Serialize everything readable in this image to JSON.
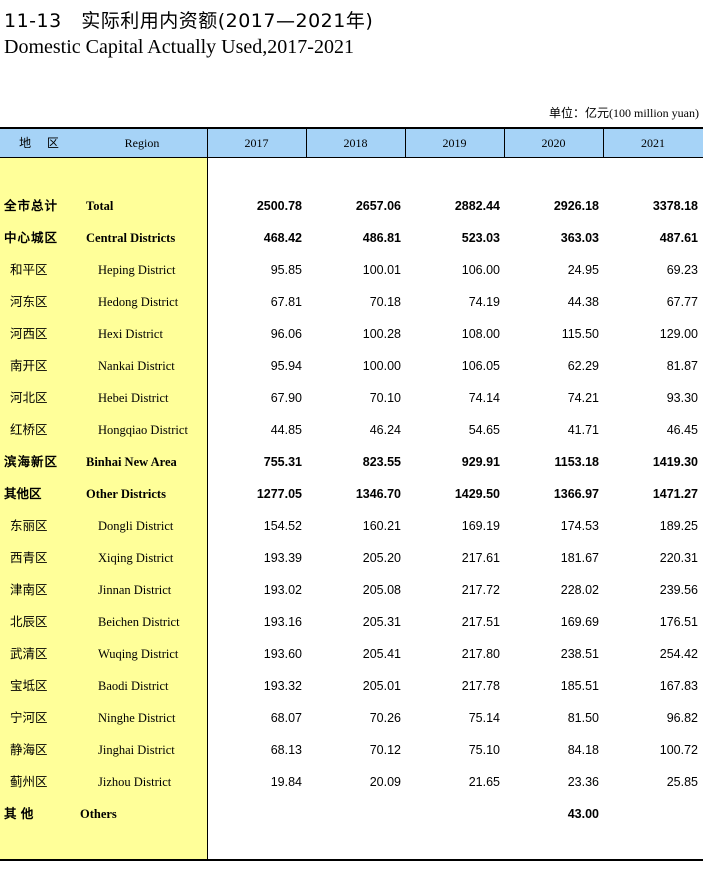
{
  "title_cn": "11-13　实际利用内资额(2017—2021年)",
  "title_en": "Domestic Capital Actually Used,2017-2021",
  "unit_cn": "单位：亿元",
  "unit_en": "(100 million yuan)",
  "header": {
    "region_cn": "地 区",
    "region_en": "Region",
    "years": [
      "2017",
      "2018",
      "2019",
      "2020",
      "2021"
    ]
  },
  "rows": [
    {
      "cn": "全市总计",
      "en": "Total",
      "bold": true,
      "level": "top",
      "values": [
        "2500.78",
        "2657.06",
        "2882.44",
        "2926.18",
        "3378.18"
      ]
    },
    {
      "cn": "中心城区",
      "en": "Central Districts",
      "bold": true,
      "level": "top",
      "values": [
        "468.42",
        "486.81",
        "523.03",
        "363.03",
        "487.61"
      ]
    },
    {
      "cn": "和平区",
      "en": "Heping District",
      "bold": false,
      "level": "sub",
      "values": [
        "95.85",
        "100.01",
        "106.00",
        "24.95",
        "69.23"
      ]
    },
    {
      "cn": "河东区",
      "en": "Hedong District",
      "bold": false,
      "level": "sub",
      "values": [
        "67.81",
        "70.18",
        "74.19",
        "44.38",
        "67.77"
      ]
    },
    {
      "cn": "河西区",
      "en": "Hexi District",
      "bold": false,
      "level": "sub",
      "values": [
        "96.06",
        "100.28",
        "108.00",
        "115.50",
        "129.00"
      ]
    },
    {
      "cn": "南开区",
      "en": "Nankai District",
      "bold": false,
      "level": "sub",
      "values": [
        "95.94",
        "100.00",
        "106.05",
        "62.29",
        "81.87"
      ]
    },
    {
      "cn": "河北区",
      "en": "Hebei District",
      "bold": false,
      "level": "sub",
      "values": [
        "67.90",
        "70.10",
        "74.14",
        "74.21",
        "93.30"
      ]
    },
    {
      "cn": "红桥区",
      "en": "Hongqiao District",
      "bold": false,
      "level": "sub",
      "values": [
        "44.85",
        "46.24",
        "54.65",
        "41.71",
        "46.45"
      ]
    },
    {
      "cn": "滨海新区",
      "en": "Binhai New Area",
      "bold": true,
      "level": "top",
      "values": [
        "755.31",
        "823.55",
        "929.91",
        "1153.18",
        "1419.30"
      ]
    },
    {
      "cn": "其他区",
      "en": "Other Districts",
      "bold": true,
      "level": "top",
      "values": [
        "1277.05",
        "1346.70",
        "1429.50",
        "1366.97",
        "1471.27"
      ]
    },
    {
      "cn": "东丽区",
      "en": "Dongli District",
      "bold": false,
      "level": "sub",
      "values": [
        "154.52",
        "160.21",
        "169.19",
        "174.53",
        "189.25"
      ]
    },
    {
      "cn": "西青区",
      "en": "Xiqing District",
      "bold": false,
      "level": "sub",
      "values": [
        "193.39",
        "205.20",
        "217.61",
        "181.67",
        "220.31"
      ]
    },
    {
      "cn": "津南区",
      "en": "Jinnan District",
      "bold": false,
      "level": "sub",
      "values": [
        "193.02",
        "205.08",
        "217.72",
        "228.02",
        "239.56"
      ]
    },
    {
      "cn": "北辰区",
      "en": "Beichen District",
      "bold": false,
      "level": "sub",
      "values": [
        "193.16",
        "205.31",
        "217.51",
        "169.69",
        "176.51"
      ]
    },
    {
      "cn": "武清区",
      "en": "Wuqing District",
      "bold": false,
      "level": "sub",
      "values": [
        "193.60",
        "205.41",
        "217.80",
        "238.51",
        "254.42"
      ]
    },
    {
      "cn": "宝坻区",
      "en": "Baodi District",
      "bold": false,
      "level": "sub",
      "values": [
        "193.32",
        "205.01",
        "217.78",
        "185.51",
        "167.83"
      ]
    },
    {
      "cn": "宁河区",
      "en": "Ninghe District",
      "bold": false,
      "level": "sub",
      "values": [
        "68.07",
        "70.26",
        "75.14",
        "81.50",
        "96.82"
      ]
    },
    {
      "cn": "静海区",
      "en": "Jinghai District",
      "bold": false,
      "level": "sub",
      "values": [
        "68.13",
        "70.12",
        "75.10",
        "84.18",
        "100.72"
      ]
    },
    {
      "cn": "蓟州区",
      "en": "Jizhou District",
      "bold": false,
      "level": "sub",
      "values": [
        "19.84",
        "20.09",
        "21.65",
        "23.36",
        "25.85"
      ]
    },
    {
      "cn": "其 他",
      "en": "Others",
      "bold": true,
      "level": "top",
      "values": [
        "",
        "",
        "",
        "43.00",
        ""
      ]
    }
  ],
  "colors": {
    "header_bg": "#a6d3f7",
    "region_bg": "#ffff99"
  }
}
